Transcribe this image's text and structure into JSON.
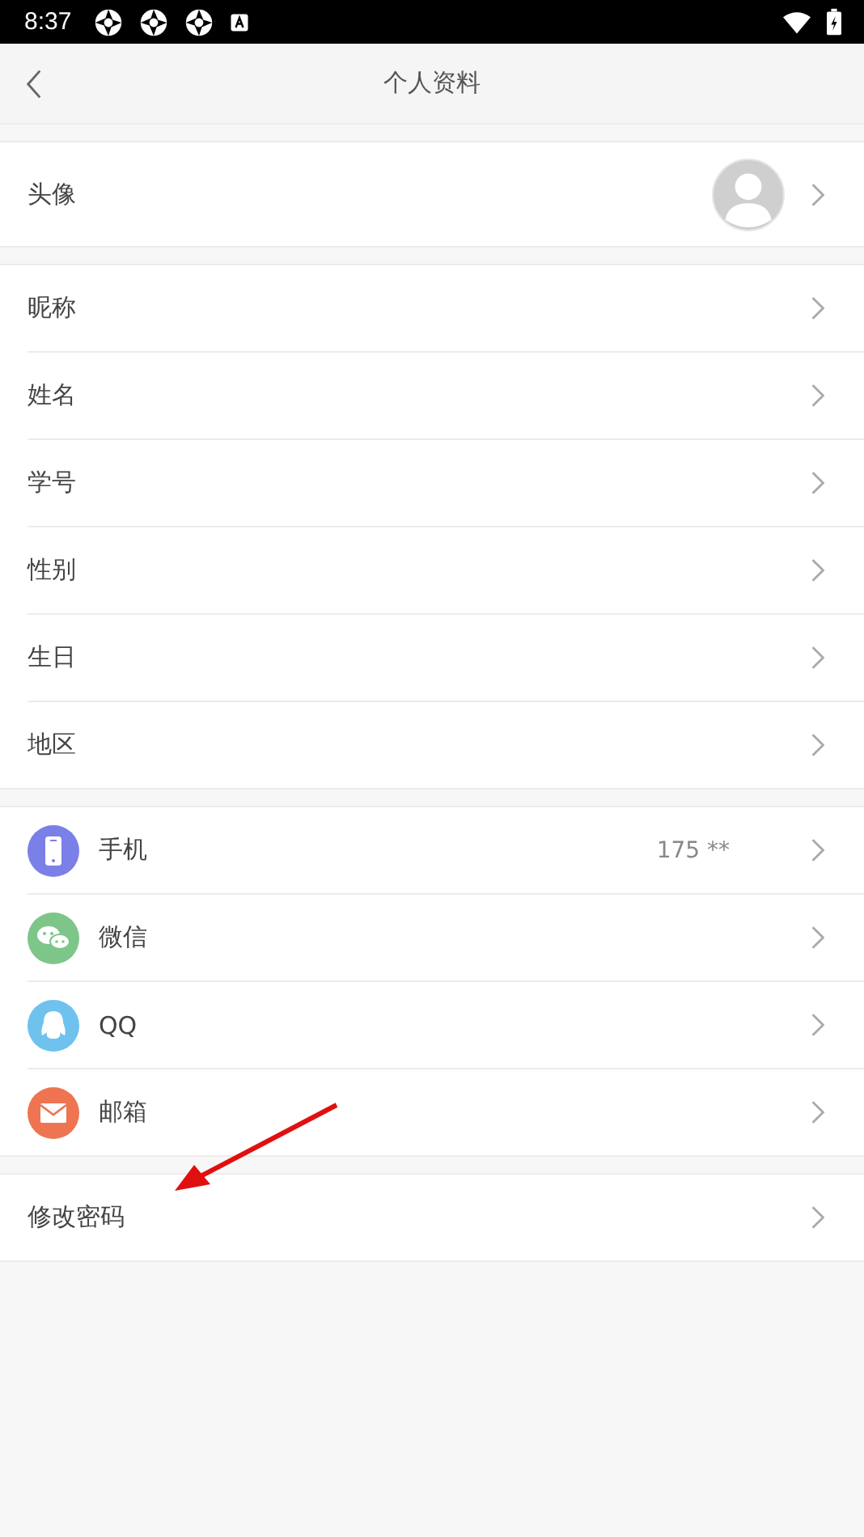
{
  "status_bar": {
    "time": "8:37"
  },
  "nav": {
    "title": "个人资料"
  },
  "avatar_row": {
    "label": "头像"
  },
  "info_rows": [
    {
      "label": "昵称"
    },
    {
      "label": "姓名"
    },
    {
      "label": "学号"
    },
    {
      "label": "性别"
    },
    {
      "label": "生日"
    },
    {
      "label": "地区"
    }
  ],
  "account_rows": [
    {
      "label": "手机",
      "kind": "phone",
      "color": "#7b7fe8",
      "value": "175 **"
    },
    {
      "label": "微信",
      "kind": "wechat",
      "color": "#7ec58a"
    },
    {
      "label": "QQ",
      "kind": "qq",
      "color": "#6fc2ee"
    },
    {
      "label": "邮箱",
      "kind": "mail",
      "color": "#ee7452"
    }
  ],
  "password_row": {
    "label": "修改密码"
  }
}
